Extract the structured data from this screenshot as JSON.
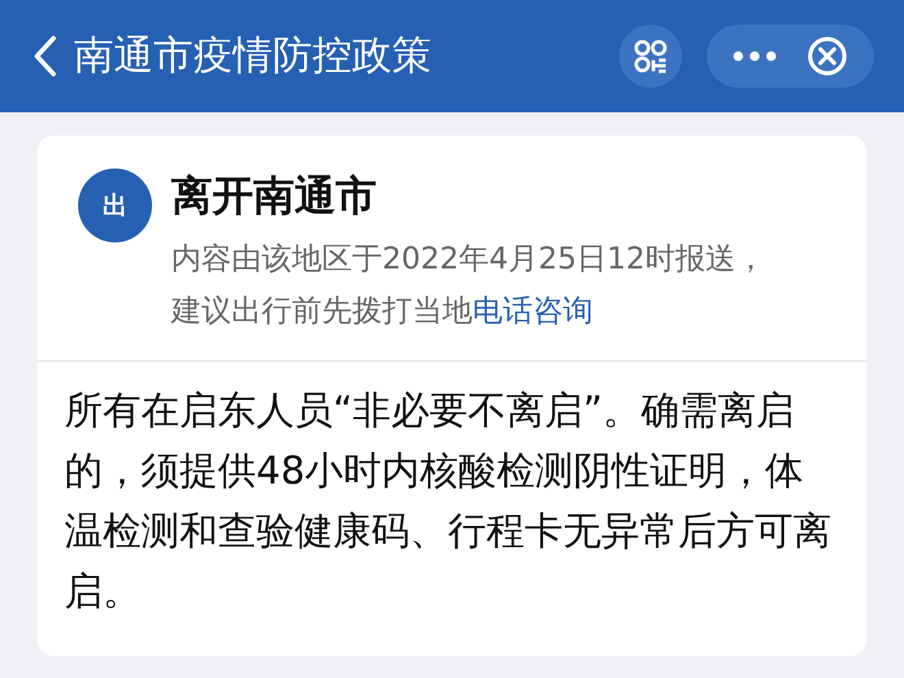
{
  "header": {
    "title": "南通市疫情防控政策"
  },
  "card": {
    "badge": "出",
    "title": "离开南通市",
    "source_text": "内容由该地区于2022年4月25日12时报送，建议出行前先拨打当地",
    "source_link": "电话咨询",
    "body": "所有在启东人员“非必要不离启”。确需离启的，须提供48小时内核酸检测阴性证明，体温检测和查验健康码、行程卡无异常后方可离启。"
  }
}
